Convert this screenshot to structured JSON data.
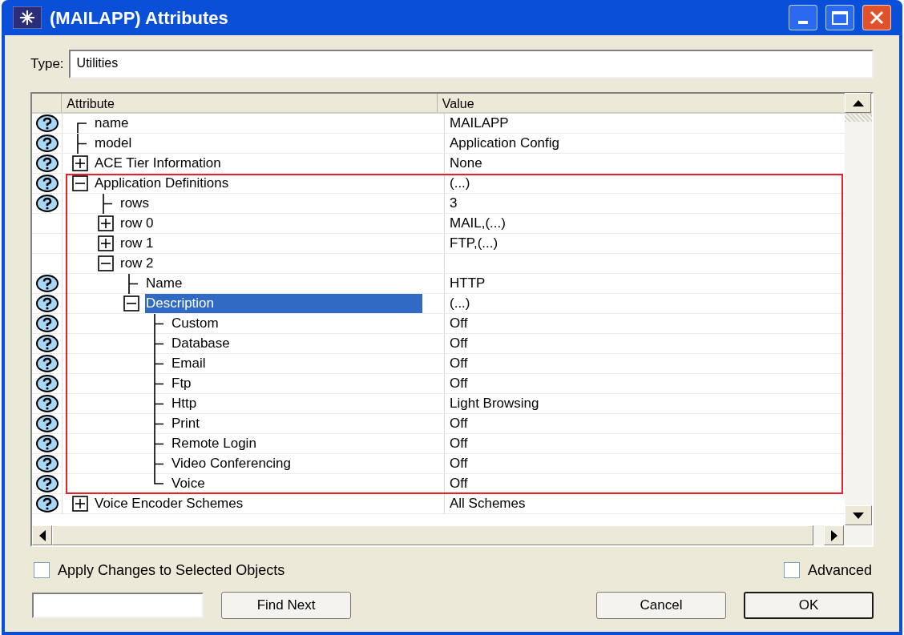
{
  "window": {
    "title": "(MAILAPP) Attributes"
  },
  "type_field": {
    "label": "Type:",
    "value": "Utilities"
  },
  "table": {
    "columns": [
      "Attribute",
      "Value"
    ],
    "rows": [
      {
        "attribute": "name",
        "value": "MAILAPP",
        "help": true,
        "selected": false
      },
      {
        "attribute": "model",
        "value": "Application Config",
        "help": true,
        "selected": false
      },
      {
        "attribute": "ACE Tier Information",
        "value": "None",
        "help": true,
        "selected": false,
        "expanded": false
      },
      {
        "attribute": "Application Definitions",
        "value": "(...)",
        "help": true,
        "selected": false,
        "expanded": true,
        "outlined": true,
        "children": [
          {
            "attribute": "rows",
            "value": "3",
            "help": true,
            "selected": false
          },
          {
            "attribute": "row 0",
            "value": "MAIL,(...)",
            "help": false,
            "selected": false,
            "expanded": false
          },
          {
            "attribute": "row 1",
            "value": "FTP,(...)",
            "help": false,
            "selected": false,
            "expanded": false
          },
          {
            "attribute": "row 2",
            "help": false,
            "selected": false,
            "expanded": true,
            "children": [
              {
                "attribute": "Name",
                "value": "HTTP",
                "help": true,
                "selected": false
              },
              {
                "attribute": "Description",
                "value": "(...)",
                "help": true,
                "selected": true,
                "expanded": true,
                "children": [
                  {
                    "attribute": "Custom",
                    "value": "Off",
                    "help": true,
                    "selected": false
                  },
                  {
                    "attribute": "Database",
                    "value": "Off",
                    "help": true,
                    "selected": false
                  },
                  {
                    "attribute": "Email",
                    "value": "Off",
                    "help": true,
                    "selected": false
                  },
                  {
                    "attribute": "Ftp",
                    "value": "Off",
                    "help": true,
                    "selected": false
                  },
                  {
                    "attribute": "Http",
                    "value": "Light Browsing",
                    "help": true,
                    "selected": false
                  },
                  {
                    "attribute": "Print",
                    "value": "Off",
                    "help": true,
                    "selected": false
                  },
                  {
                    "attribute": "Remote Login",
                    "value": "Off",
                    "help": true,
                    "selected": false
                  },
                  {
                    "attribute": "Video Conferencing",
                    "value": "Off",
                    "help": true,
                    "selected": false
                  },
                  {
                    "attribute": "Voice",
                    "value": "Off",
                    "help": true,
                    "selected": false
                  }
                ]
              }
            ]
          }
        ]
      },
      {
        "attribute": "Voice Encoder Schemes",
        "value": "All Schemes",
        "help": true,
        "selected": false,
        "expanded": false
      }
    ]
  },
  "apply_checkbox": {
    "label": "Apply Changes to Selected Objects",
    "checked": false
  },
  "advanced_checkbox": {
    "label": "Advanced",
    "checked": false
  },
  "buttons": [
    {
      "label": "Find Next",
      "default": false
    },
    {
      "label": "Cancel",
      "default": false
    },
    {
      "label": "OK",
      "default": true
    }
  ]
}
